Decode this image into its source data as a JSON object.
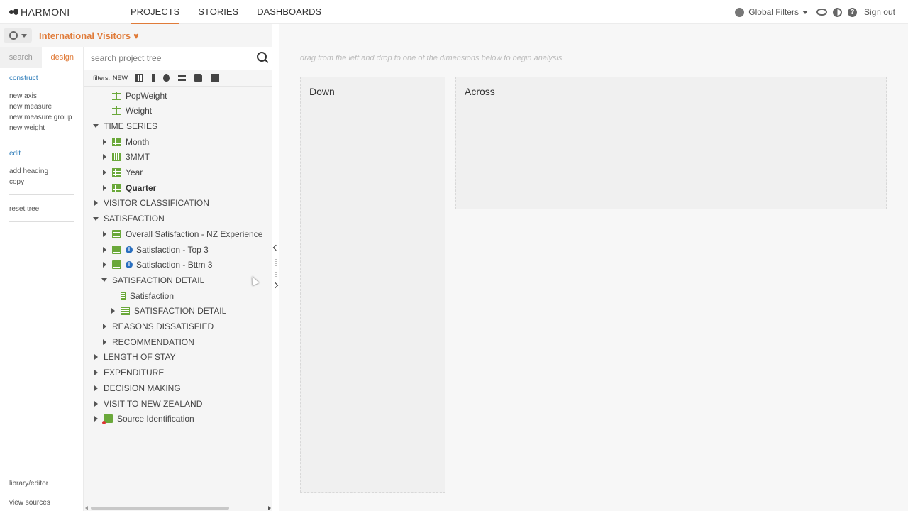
{
  "app": {
    "brand": "HARMONI"
  },
  "nav": {
    "tabs": [
      "PROJECTS",
      "STORIES",
      "DASHBOARDS"
    ],
    "active": 0
  },
  "topright": {
    "global_filters": "Global Filters",
    "sign_out": "Sign out"
  },
  "project": {
    "title": "International Visitors"
  },
  "design_panel": {
    "tabs": [
      "search",
      "design"
    ],
    "active_tab": 1,
    "construct_heading": "construct",
    "construct_items": [
      "new axis",
      "new measure",
      "new measure group",
      "new weight"
    ],
    "edit_heading": "edit",
    "edit_items": [
      "add heading",
      "copy"
    ],
    "reset": "reset tree",
    "library_editor": "library/editor",
    "view_sources": "view sources"
  },
  "tree_search": {
    "placeholder": "search project tree"
  },
  "filters": {
    "label": "filters:",
    "new": "NEW"
  },
  "tree": [
    {
      "label": "PopWeight",
      "icon": "scale-icon",
      "level": 1,
      "toggle": "none"
    },
    {
      "label": "Weight",
      "icon": "scale-icon",
      "level": 1,
      "toggle": "none"
    },
    {
      "label": "TIME SERIES",
      "icon": "",
      "level": 0,
      "toggle": "down"
    },
    {
      "label": "Month",
      "icon": "grid-icon",
      "level": 1,
      "toggle": "right"
    },
    {
      "label": "3MMT",
      "icon": "bar-icon",
      "level": 1,
      "toggle": "right"
    },
    {
      "label": "Year",
      "icon": "grid-icon",
      "level": 1,
      "toggle": "right"
    },
    {
      "label": "Quarter",
      "icon": "grid-icon",
      "level": 1,
      "toggle": "right",
      "bold": true
    },
    {
      "label": "VISITOR CLASSIFICATION",
      "icon": "",
      "level": 0,
      "toggle": "right"
    },
    {
      "label": "SATISFACTION",
      "icon": "",
      "level": 0,
      "toggle": "down"
    },
    {
      "label": "Overall Satisfaction - NZ Experience",
      "icon": "doc-icon",
      "level": 1,
      "toggle": "right"
    },
    {
      "label": "Satisfaction - Top 3",
      "icon": "doc-icon",
      "level": 1,
      "toggle": "right",
      "info": true
    },
    {
      "label": "Satisfaction - Bttm 3",
      "icon": "doc-icon",
      "level": 1,
      "toggle": "right",
      "info": true
    },
    {
      "label": "SATISFACTION DETAIL",
      "icon": "",
      "level": 1,
      "toggle": "down"
    },
    {
      "label": "Satisfaction",
      "icon": "ruler-icon",
      "level": 2,
      "toggle": "none"
    },
    {
      "label": "SATISFACTION DETAIL",
      "icon": "dense-grid-icon",
      "level": 2,
      "toggle": "right"
    },
    {
      "label": "REASONS DISSATISFIED",
      "icon": "",
      "level": 1,
      "toggle": "right"
    },
    {
      "label": "RECOMMENDATION",
      "icon": "",
      "level": 1,
      "toggle": "right"
    },
    {
      "label": "LENGTH OF STAY",
      "icon": "",
      "level": 0,
      "toggle": "right"
    },
    {
      "label": "EXPENDITURE",
      "icon": "",
      "level": 0,
      "toggle": "right"
    },
    {
      "label": "DECISION MAKING",
      "icon": "",
      "level": 0,
      "toggle": "right"
    },
    {
      "label": "VISIT TO NEW ZEALAND",
      "icon": "",
      "level": 0,
      "toggle": "right"
    },
    {
      "label": "Source Identification",
      "icon": "source-icon",
      "level": 0,
      "toggle": "right"
    }
  ],
  "canvas": {
    "hint": "drag from the left and drop to one of the dimensions below to begin analysis",
    "down_label": "Down",
    "across_label": "Across"
  },
  "colors": {
    "accent": "#e07b39",
    "icon_green": "#6aa83a",
    "link_blue": "#2a7ab8"
  }
}
